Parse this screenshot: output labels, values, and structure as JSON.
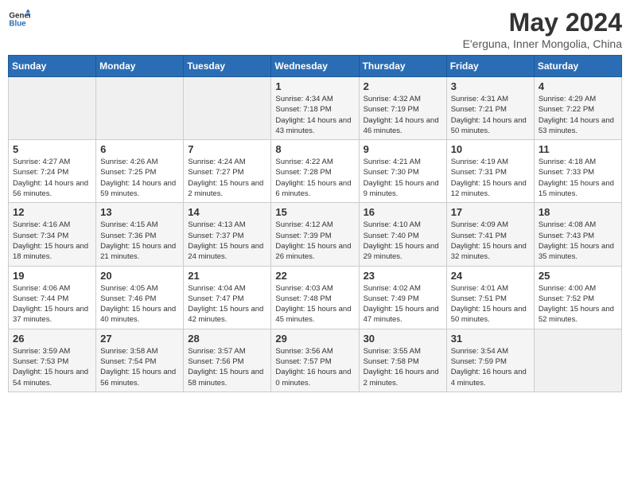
{
  "header": {
    "logo_line1": "General",
    "logo_line2": "Blue",
    "month": "May 2024",
    "location": "E'erguna, Inner Mongolia, China"
  },
  "weekdays": [
    "Sunday",
    "Monday",
    "Tuesday",
    "Wednesday",
    "Thursday",
    "Friday",
    "Saturday"
  ],
  "weeks": [
    [
      {
        "day": "",
        "empty": true
      },
      {
        "day": "",
        "empty": true
      },
      {
        "day": "",
        "empty": true
      },
      {
        "day": "1",
        "sunrise": "Sunrise: 4:34 AM",
        "sunset": "Sunset: 7:18 PM",
        "daylight": "Daylight: 14 hours and 43 minutes."
      },
      {
        "day": "2",
        "sunrise": "Sunrise: 4:32 AM",
        "sunset": "Sunset: 7:19 PM",
        "daylight": "Daylight: 14 hours and 46 minutes."
      },
      {
        "day": "3",
        "sunrise": "Sunrise: 4:31 AM",
        "sunset": "Sunset: 7:21 PM",
        "daylight": "Daylight: 14 hours and 50 minutes."
      },
      {
        "day": "4",
        "sunrise": "Sunrise: 4:29 AM",
        "sunset": "Sunset: 7:22 PM",
        "daylight": "Daylight: 14 hours and 53 minutes."
      }
    ],
    [
      {
        "day": "5",
        "sunrise": "Sunrise: 4:27 AM",
        "sunset": "Sunset: 7:24 PM",
        "daylight": "Daylight: 14 hours and 56 minutes."
      },
      {
        "day": "6",
        "sunrise": "Sunrise: 4:26 AM",
        "sunset": "Sunset: 7:25 PM",
        "daylight": "Daylight: 14 hours and 59 minutes."
      },
      {
        "day": "7",
        "sunrise": "Sunrise: 4:24 AM",
        "sunset": "Sunset: 7:27 PM",
        "daylight": "Daylight: 15 hours and 2 minutes."
      },
      {
        "day": "8",
        "sunrise": "Sunrise: 4:22 AM",
        "sunset": "Sunset: 7:28 PM",
        "daylight": "Daylight: 15 hours and 6 minutes."
      },
      {
        "day": "9",
        "sunrise": "Sunrise: 4:21 AM",
        "sunset": "Sunset: 7:30 PM",
        "daylight": "Daylight: 15 hours and 9 minutes."
      },
      {
        "day": "10",
        "sunrise": "Sunrise: 4:19 AM",
        "sunset": "Sunset: 7:31 PM",
        "daylight": "Daylight: 15 hours and 12 minutes."
      },
      {
        "day": "11",
        "sunrise": "Sunrise: 4:18 AM",
        "sunset": "Sunset: 7:33 PM",
        "daylight": "Daylight: 15 hours and 15 minutes."
      }
    ],
    [
      {
        "day": "12",
        "sunrise": "Sunrise: 4:16 AM",
        "sunset": "Sunset: 7:34 PM",
        "daylight": "Daylight: 15 hours and 18 minutes."
      },
      {
        "day": "13",
        "sunrise": "Sunrise: 4:15 AM",
        "sunset": "Sunset: 7:36 PM",
        "daylight": "Daylight: 15 hours and 21 minutes."
      },
      {
        "day": "14",
        "sunrise": "Sunrise: 4:13 AM",
        "sunset": "Sunset: 7:37 PM",
        "daylight": "Daylight: 15 hours and 24 minutes."
      },
      {
        "day": "15",
        "sunrise": "Sunrise: 4:12 AM",
        "sunset": "Sunset: 7:39 PM",
        "daylight": "Daylight: 15 hours and 26 minutes."
      },
      {
        "day": "16",
        "sunrise": "Sunrise: 4:10 AM",
        "sunset": "Sunset: 7:40 PM",
        "daylight": "Daylight: 15 hours and 29 minutes."
      },
      {
        "day": "17",
        "sunrise": "Sunrise: 4:09 AM",
        "sunset": "Sunset: 7:41 PM",
        "daylight": "Daylight: 15 hours and 32 minutes."
      },
      {
        "day": "18",
        "sunrise": "Sunrise: 4:08 AM",
        "sunset": "Sunset: 7:43 PM",
        "daylight": "Daylight: 15 hours and 35 minutes."
      }
    ],
    [
      {
        "day": "19",
        "sunrise": "Sunrise: 4:06 AM",
        "sunset": "Sunset: 7:44 PM",
        "daylight": "Daylight: 15 hours and 37 minutes."
      },
      {
        "day": "20",
        "sunrise": "Sunrise: 4:05 AM",
        "sunset": "Sunset: 7:46 PM",
        "daylight": "Daylight: 15 hours and 40 minutes."
      },
      {
        "day": "21",
        "sunrise": "Sunrise: 4:04 AM",
        "sunset": "Sunset: 7:47 PM",
        "daylight": "Daylight: 15 hours and 42 minutes."
      },
      {
        "day": "22",
        "sunrise": "Sunrise: 4:03 AM",
        "sunset": "Sunset: 7:48 PM",
        "daylight": "Daylight: 15 hours and 45 minutes."
      },
      {
        "day": "23",
        "sunrise": "Sunrise: 4:02 AM",
        "sunset": "Sunset: 7:49 PM",
        "daylight": "Daylight: 15 hours and 47 minutes."
      },
      {
        "day": "24",
        "sunrise": "Sunrise: 4:01 AM",
        "sunset": "Sunset: 7:51 PM",
        "daylight": "Daylight: 15 hours and 50 minutes."
      },
      {
        "day": "25",
        "sunrise": "Sunrise: 4:00 AM",
        "sunset": "Sunset: 7:52 PM",
        "daylight": "Daylight: 15 hours and 52 minutes."
      }
    ],
    [
      {
        "day": "26",
        "sunrise": "Sunrise: 3:59 AM",
        "sunset": "Sunset: 7:53 PM",
        "daylight": "Daylight: 15 hours and 54 minutes."
      },
      {
        "day": "27",
        "sunrise": "Sunrise: 3:58 AM",
        "sunset": "Sunset: 7:54 PM",
        "daylight": "Daylight: 15 hours and 56 minutes."
      },
      {
        "day": "28",
        "sunrise": "Sunrise: 3:57 AM",
        "sunset": "Sunset: 7:56 PM",
        "daylight": "Daylight: 15 hours and 58 minutes."
      },
      {
        "day": "29",
        "sunrise": "Sunrise: 3:56 AM",
        "sunset": "Sunset: 7:57 PM",
        "daylight": "Daylight: 16 hours and 0 minutes."
      },
      {
        "day": "30",
        "sunrise": "Sunrise: 3:55 AM",
        "sunset": "Sunset: 7:58 PM",
        "daylight": "Daylight: 16 hours and 2 minutes."
      },
      {
        "day": "31",
        "sunrise": "Sunrise: 3:54 AM",
        "sunset": "Sunset: 7:59 PM",
        "daylight": "Daylight: 16 hours and 4 minutes."
      },
      {
        "day": "",
        "empty": true
      }
    ]
  ]
}
